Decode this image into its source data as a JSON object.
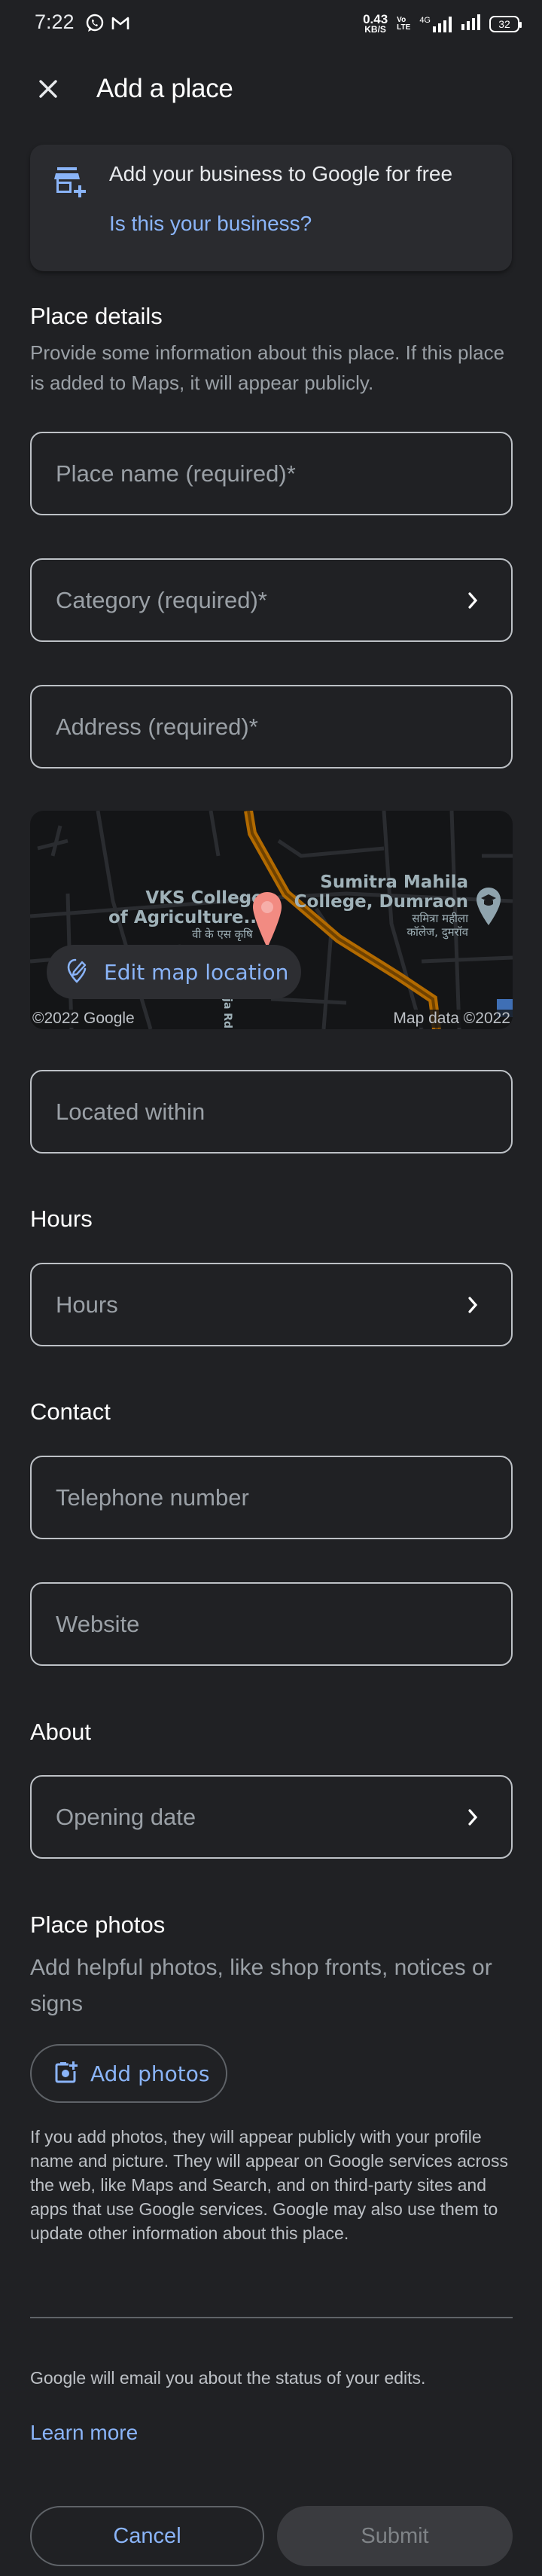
{
  "status_bar": {
    "time": "7:22",
    "notification_icons": [
      "whatsapp-icon",
      "gmail-icon"
    ],
    "net_speed_value": "0.43",
    "net_speed_unit": "KB/S",
    "volte_top": "Vo",
    "volte_bottom": "LTE",
    "network_type": "4G",
    "battery_level": "32"
  },
  "app_bar": {
    "close_icon": "close-icon",
    "title": "Add a place"
  },
  "business_card": {
    "icon": "add-business-icon",
    "text": "Add your business to Google for free",
    "link": "Is this your business?"
  },
  "place_details": {
    "heading": "Place details",
    "description": "Provide some information about this place. If this place is added to Maps, it will appear publicly.",
    "place_name_placeholder": "Place name (required)*",
    "category_placeholder": "Category (required)*",
    "address_placeholder": "Address (required)*"
  },
  "map": {
    "label_left_line1": "VKS College",
    "label_left_line2": "of Agriculture...",
    "label_left_hindi": "वी के एस कृषि",
    "label_right_line1": "Sumitra Mahila",
    "label_right_line2": "College, Dumraon",
    "label_right_hindi1": "समित्रा महीला",
    "label_right_hindi2": "कॉलेज, दुमरॉव",
    "road_label": "Maharaja Rd",
    "edit_button": "Edit map location",
    "attribution_left": "©2022 Google",
    "attribution_right": "Map data ©2022",
    "colors": {
      "road": "#b26a00",
      "pin": "#f28b82",
      "poi_pin": "#8fa3ad"
    }
  },
  "located_within": {
    "placeholder": "Located within"
  },
  "hours": {
    "heading": "Hours",
    "placeholder": "Hours"
  },
  "contact": {
    "heading": "Contact",
    "telephone_placeholder": "Telephone number",
    "website_placeholder": "Website"
  },
  "about": {
    "heading": "About",
    "opening_date_placeholder": "Opening date"
  },
  "photos": {
    "heading": "Place photos",
    "description": "Add helpful photos, like shop fronts, notices or signs",
    "add_button": "Add photos",
    "disclaimer": "If you add photos, they will appear publicly with your profile name and picture. They will appear on Google services across the web, like Maps and Search, and on third-party sites and apps that use Google services. Google may also use them to update other information about this place."
  },
  "footer": {
    "email_note": "Google will email you about the status of your edits.",
    "learn_more": "Learn more",
    "cancel": "Cancel",
    "submit": "Submit"
  },
  "theme": {
    "background": "#202124",
    "accent": "#8ab4f8",
    "text_primary": "#e8eaed",
    "text_secondary": "#9aa0a6"
  }
}
